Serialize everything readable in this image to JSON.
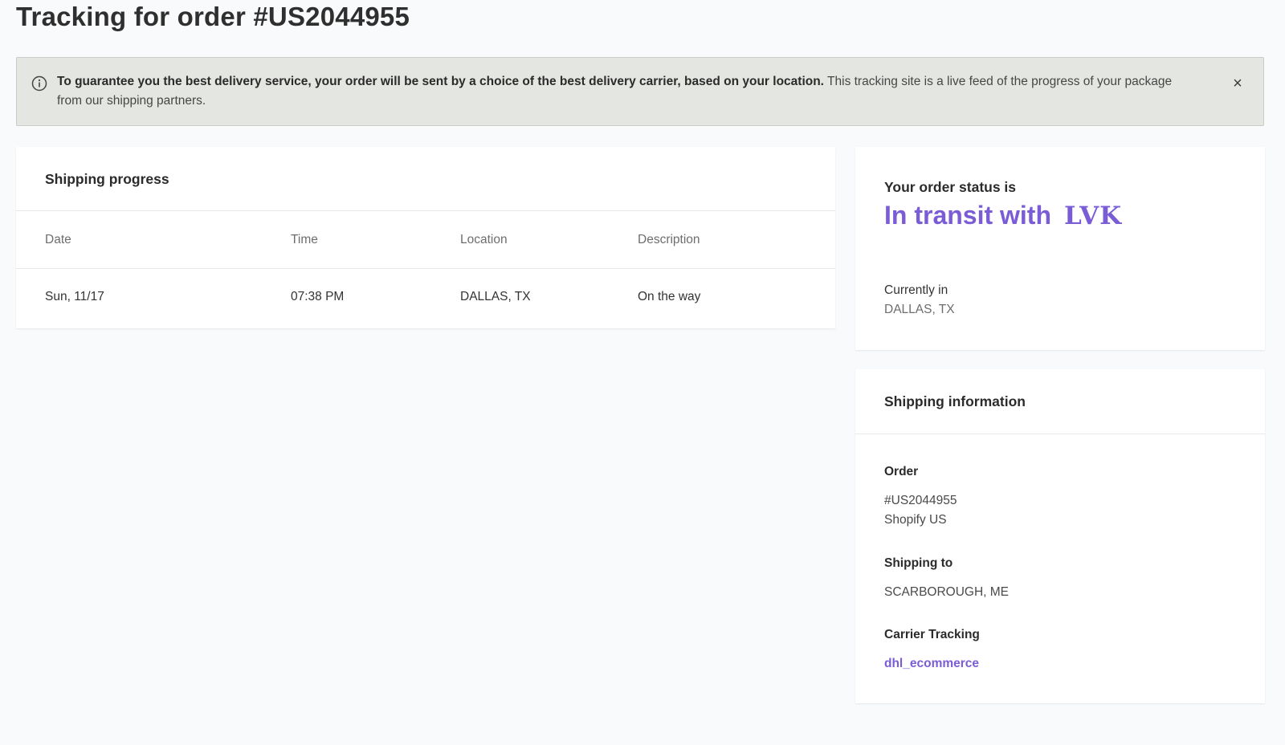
{
  "page": {
    "title": "Tracking for order #US2044955"
  },
  "banner": {
    "bold_text": "To guarantee you the best delivery service, your order will be sent by a choice of the best delivery carrier, based on your location.",
    "text": "This tracking site is a live feed of the progress of your package from our shipping partners.",
    "icon": "info-icon",
    "close_label": "×"
  },
  "progress": {
    "heading": "Shipping progress",
    "columns": [
      "Date",
      "Time",
      "Location",
      "Description"
    ],
    "rows": [
      {
        "date": "Sun, 11/17",
        "time": "07:38 PM",
        "location": "DALLAS, TX",
        "description": "On the way"
      }
    ]
  },
  "status": {
    "label": "Your order status is",
    "value": "In transit with",
    "carrier_logo": "LVK",
    "current_label": "Currently in",
    "current_location": "DALLAS, TX"
  },
  "shipping_info": {
    "heading": "Shipping information",
    "order_label": "Order",
    "order_number": "#US2044955",
    "store": "Shopify US",
    "shipping_to_label": "Shipping to",
    "shipping_to": "SCARBOROUGH, ME",
    "carrier_tracking_label": "Carrier Tracking",
    "carrier_tracking": "dhl_ecommerce"
  },
  "colors": {
    "accent": "#7a5dd6",
    "banner_bg": "#e4e6e1",
    "page_bg": "#f9fafb"
  }
}
